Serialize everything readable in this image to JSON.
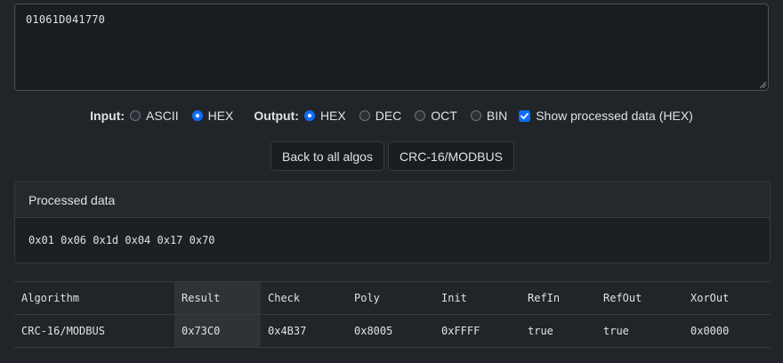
{
  "input_text": "01061D041770",
  "options": {
    "input_label": "Input:",
    "input_options": [
      {
        "label": "ASCII",
        "selected": false
      },
      {
        "label": "HEX",
        "selected": true
      }
    ],
    "output_label": "Output:",
    "output_options": [
      {
        "label": "HEX",
        "selected": true
      },
      {
        "label": "DEC",
        "selected": false
      },
      {
        "label": "OCT",
        "selected": false
      },
      {
        "label": "BIN",
        "selected": false
      }
    ],
    "show_processed_label": "Show processed data (HEX)",
    "show_processed_checked": true
  },
  "buttons": {
    "back": "Back to all algos",
    "algo": "CRC-16/MODBUS"
  },
  "processed": {
    "title": "Processed data",
    "data": "0x01 0x06 0x1d 0x04 0x17 0x70"
  },
  "table": {
    "headers": [
      "Algorithm",
      "Result",
      "Check",
      "Poly",
      "Init",
      "RefIn",
      "RefOut",
      "XorOut"
    ],
    "rows": [
      [
        "CRC-16/MODBUS",
        "0x73C0",
        "0x4B37",
        "0x8005",
        "0xFFFF",
        "true",
        "true",
        "0x0000"
      ]
    ]
  },
  "colors": {
    "accent": "#0d6efd",
    "background": "#212529",
    "highlight_column": "#2f3338"
  }
}
